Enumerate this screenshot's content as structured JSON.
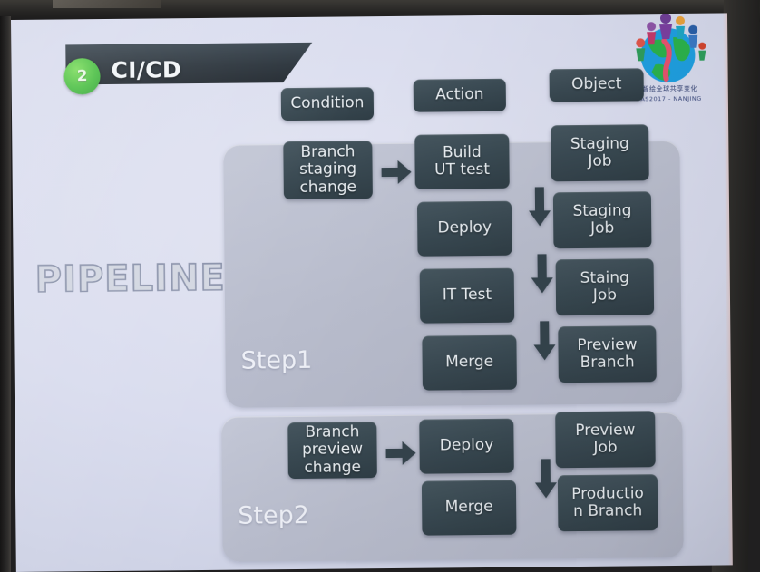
{
  "slide": {
    "section_number": "2",
    "section_title": "CI/CD",
    "watermark": "PIPELINE"
  },
  "logo": {
    "name": "conference-globe-logo",
    "chinese_text": "智绘全球共享变化",
    "latin_text": "IAS2017 - NANJING"
  },
  "column_headers": [
    {
      "label": "Condition"
    },
    {
      "label": "Action"
    },
    {
      "label": "Object"
    }
  ],
  "steps": [
    {
      "label": "Step1",
      "condition": "Branch\nstaging\nchange",
      "actions": [
        {
          "label": "Build\nUT test"
        },
        {
          "label": "Deploy"
        },
        {
          "label": "IT Test"
        },
        {
          "label": "Merge"
        }
      ],
      "objects": [
        {
          "label": "Staging\nJob"
        },
        {
          "label": "Staging\nJob"
        },
        {
          "label": "Staing\nJob"
        },
        {
          "label": "Preview\nBranch"
        }
      ]
    },
    {
      "label": "Step2",
      "condition": "Branch\npreview\nchange",
      "actions": [
        {
          "label": "Deploy"
        },
        {
          "label": "Merge"
        }
      ],
      "objects": [
        {
          "label": "Preview\nJob"
        },
        {
          "label": "Productio\nn Branch"
        }
      ]
    }
  ],
  "colors": {
    "chip_fill": "#3a4a53",
    "badge_green": "#4cbf45",
    "banner_dark": "#2b343c",
    "panel_gray": "#b9bdcd",
    "slide_bg": "#d9dcee"
  },
  "arrows": {
    "right_arrow_name": "arrow-right-icon",
    "down_arrow_name": "arrow-down-icon",
    "count_right": 2,
    "count_down": 4
  }
}
